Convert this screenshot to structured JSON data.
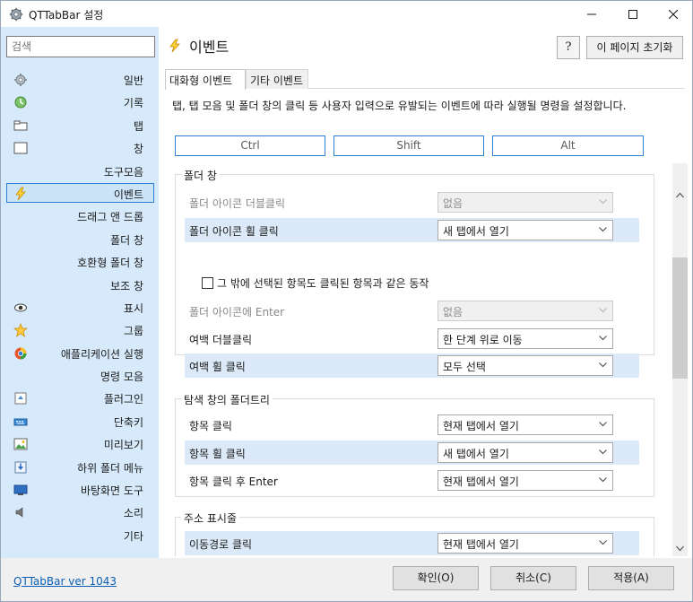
{
  "window": {
    "title": "QTTabBar 설정",
    "minimize_icon": "minimize-icon",
    "maximize_icon": "maximize-icon",
    "close_icon": "close-icon"
  },
  "sidebar": {
    "search_placeholder": "검색",
    "items": [
      {
        "label": "일반",
        "icon": "gear-icon"
      },
      {
        "label": "기록",
        "icon": "history-icon"
      },
      {
        "label": "탭",
        "icon": "tab-icon"
      },
      {
        "label": "창",
        "icon": "window-icon"
      },
      {
        "label": "도구모음",
        "icon": ""
      },
      {
        "label": "이벤트",
        "icon": "lightning-icon",
        "selected": true
      },
      {
        "label": "드래그 앤 드롭",
        "icon": ""
      },
      {
        "label": "폴더 창",
        "icon": ""
      },
      {
        "label": "호환형 폴더 창",
        "icon": ""
      },
      {
        "label": "보조 창",
        "icon": ""
      },
      {
        "label": "표시",
        "icon": "eye-icon"
      },
      {
        "label": "그룹",
        "icon": "star-icon"
      },
      {
        "label": "애플리케이션 실행",
        "icon": "app-launch-icon"
      },
      {
        "label": "명령 모음",
        "icon": ""
      },
      {
        "label": "플러그인",
        "icon": "plugin-icon"
      },
      {
        "label": "단축키",
        "icon": "keyboard-icon"
      },
      {
        "label": "미리보기",
        "icon": "preview-icon"
      },
      {
        "label": "하위 폴더 메뉴",
        "icon": "subfolder-icon"
      },
      {
        "label": "바탕화면 도구",
        "icon": "desktop-icon"
      },
      {
        "label": "소리",
        "icon": "sound-icon"
      },
      {
        "label": "기타",
        "icon": ""
      }
    ]
  },
  "header": {
    "title": "이벤트",
    "help_label": "?",
    "reset_label": "이 페이지 초기화"
  },
  "tabs": [
    {
      "label": "대화형 이벤트",
      "active": true
    },
    {
      "label": "기타 이벤트",
      "active": false
    }
  ],
  "description": "탭, 탭 모음 및 폴더 창의 클릭 등 사용자 입력으로 유발되는 이벤트에 따라 실행될 명령을 설정합니다.",
  "modifiers": [
    "Ctrl",
    "Shift",
    "Alt"
  ],
  "groups": [
    {
      "title": "폴더 창",
      "rows": [
        {
          "label": "폴더 아이콘 더블클릭",
          "value": "없음",
          "disabled": true,
          "highlight": false
        },
        {
          "label": "폴더 아이콘 휠 클릭",
          "value": "새 탭에서 열기",
          "disabled": false,
          "highlight": true
        },
        {
          "label": "폴더 아이콘에 Enter",
          "value": "없음",
          "disabled": true,
          "highlight": false
        },
        {
          "label": "여백 더블클릭",
          "value": "한 단계 위로 이동",
          "disabled": false,
          "highlight": false
        },
        {
          "label": "여백 휠 클릭",
          "value": "모두 선택",
          "disabled": false,
          "highlight": true
        }
      ],
      "checkbox_label": "그 밖에 선택된 항목도 클릭된 항목과 같은 동작",
      "checkbox_checked": false
    },
    {
      "title": "탐색 창의 폴더트리",
      "rows": [
        {
          "label": "항목 클릭",
          "value": "현재 탭에서 열기",
          "disabled": false,
          "highlight": false
        },
        {
          "label": "항목 휠 클릭",
          "value": "새 탭에서 열기",
          "disabled": false,
          "highlight": true
        },
        {
          "label": "항목 클릭 후 Enter",
          "value": "현재 탭에서 열기",
          "disabled": false,
          "highlight": false
        }
      ]
    },
    {
      "title": "주소 표시줄",
      "rows": [
        {
          "label": "이동경로 클릭",
          "value": "현재 탭에서 열기",
          "disabled": false,
          "highlight": true
        }
      ]
    }
  ],
  "footer": {
    "version_link": "QTTabBar ver 1043",
    "ok_label": "확인(O)",
    "cancel_label": "취소(C)",
    "apply_label": "적용(A)"
  },
  "colors": {
    "sidebar_bg": "#d7eafb",
    "accent": "#2c7fd1",
    "row_highlight": "#dce9f8",
    "link": "#0a5fb4"
  }
}
